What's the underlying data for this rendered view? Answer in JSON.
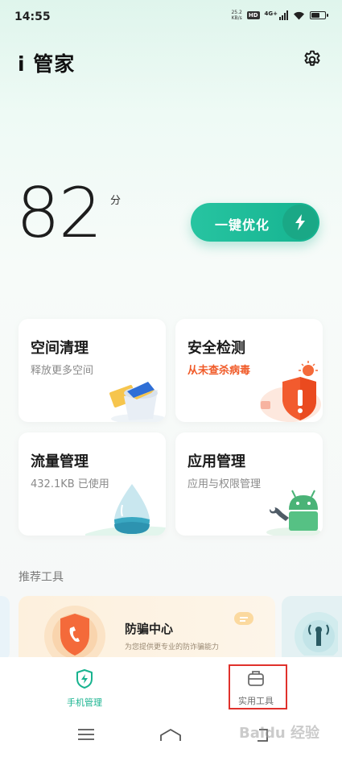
{
  "status_bar": {
    "time": "14:55",
    "net_speed_value": "25.2",
    "net_speed_unit": "KB/s",
    "hd_badge": "HD",
    "network_type": "4G+",
    "battery_level": 0.65
  },
  "header": {
    "title": "i 管家",
    "settings_icon": "gear-icon"
  },
  "score": {
    "value": "82",
    "unit": "分"
  },
  "optimize_button": {
    "label": "一键优化",
    "icon": "lightning-icon"
  },
  "cards": [
    {
      "title": "空间清理",
      "subtitle": "释放更多空间",
      "icon": "cleaning-bucket-icon"
    },
    {
      "title": "安全检测",
      "subtitle": "从未查杀病毒",
      "subtitle_color": "#f05a28",
      "icon": "security-shield-icon"
    },
    {
      "title": "流量管理",
      "subtitle": "432.1KB 已使用",
      "icon": "water-drop-icon"
    },
    {
      "title": "应用管理",
      "subtitle": "应用与权限管理",
      "icon": "android-robot-icon"
    }
  ],
  "recommended": {
    "section_title": "推荐工具",
    "tool": {
      "title": "防骗中心",
      "subtitle": "为您提供更专业的防诈骗能力",
      "icon": "fraud-shield-icon"
    }
  },
  "tabs": [
    {
      "label": "手机管理",
      "icon": "phone-manage-icon",
      "active": true
    },
    {
      "label": "实用工具",
      "icon": "toolbox-icon",
      "active": false
    }
  ],
  "watermark": "Baidu 经验",
  "colors": {
    "accent": "#18b38f",
    "warning": "#f05a28",
    "highlight_box": "#e0312c"
  }
}
